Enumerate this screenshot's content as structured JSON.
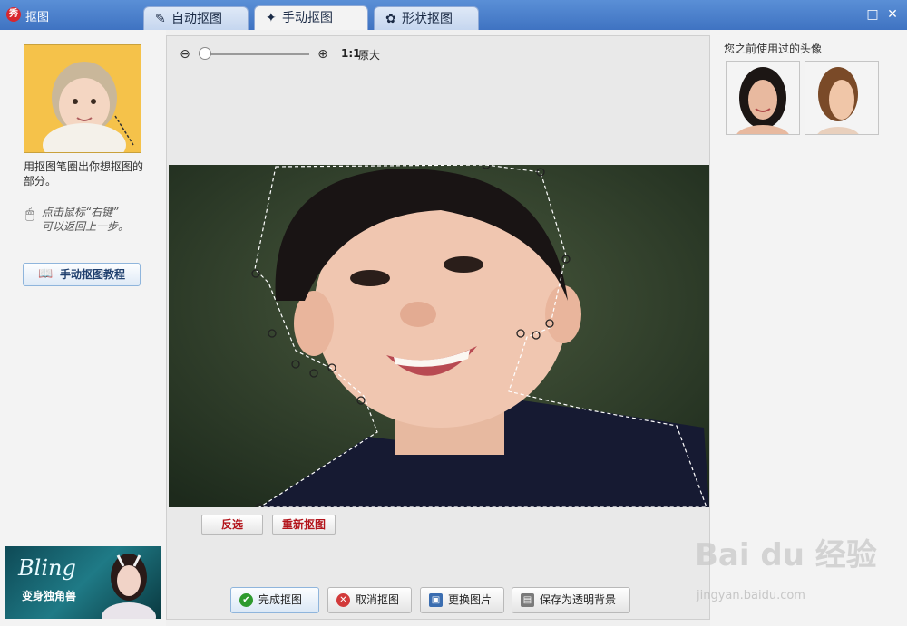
{
  "window": {
    "title": "抠图",
    "logo": "秀",
    "maximize_icon": "□",
    "close_icon": "✕"
  },
  "tabs": [
    {
      "label": "自动抠图",
      "icon": "brush-icon",
      "glyph": "✎",
      "active": false
    },
    {
      "label": "手动抠图",
      "icon": "magic-wand-icon",
      "glyph": "✦",
      "active": true
    },
    {
      "label": "形状抠图",
      "icon": "shape-icon",
      "glyph": "✿",
      "active": false
    }
  ],
  "left": {
    "hint": "用抠图笔圈出你想抠图的部分。",
    "tip_line1": "点击鼠标“右键”",
    "tip_line2": "可以返回上一步。",
    "mouse_glyph": "🖱",
    "tutorial_label": "手动抠图教程",
    "tutorial_glyph": "📖",
    "ad_title": "Bling",
    "ad_subtitle": "变身独角兽"
  },
  "zoom": {
    "out_glyph": "⊖",
    "in_glyph": "⊕",
    "ratio": "1:1",
    "label": "原大",
    "level": 0.0
  },
  "editor": {
    "invert_label": "反选",
    "recut_label": "重新抠图"
  },
  "actions": [
    {
      "label": "完成抠图",
      "icon": "check-icon",
      "glyph": "✔",
      "color": "#2e9a2e"
    },
    {
      "label": "取消抠图",
      "icon": "cancel-icon",
      "glyph": "✕",
      "color": "#d23a3a"
    },
    {
      "label": "更换图片",
      "icon": "image-icon",
      "glyph": "▣",
      "color": "#3a6db0"
    },
    {
      "label": "保存为透明背景",
      "icon": "save-icon",
      "glyph": "▤",
      "color": "#7a7a7a"
    }
  ],
  "history": {
    "title": "您之前使用过的头像"
  },
  "watermark": {
    "text": "Bai du 经验",
    "url": "jingyan.baidu.com"
  }
}
